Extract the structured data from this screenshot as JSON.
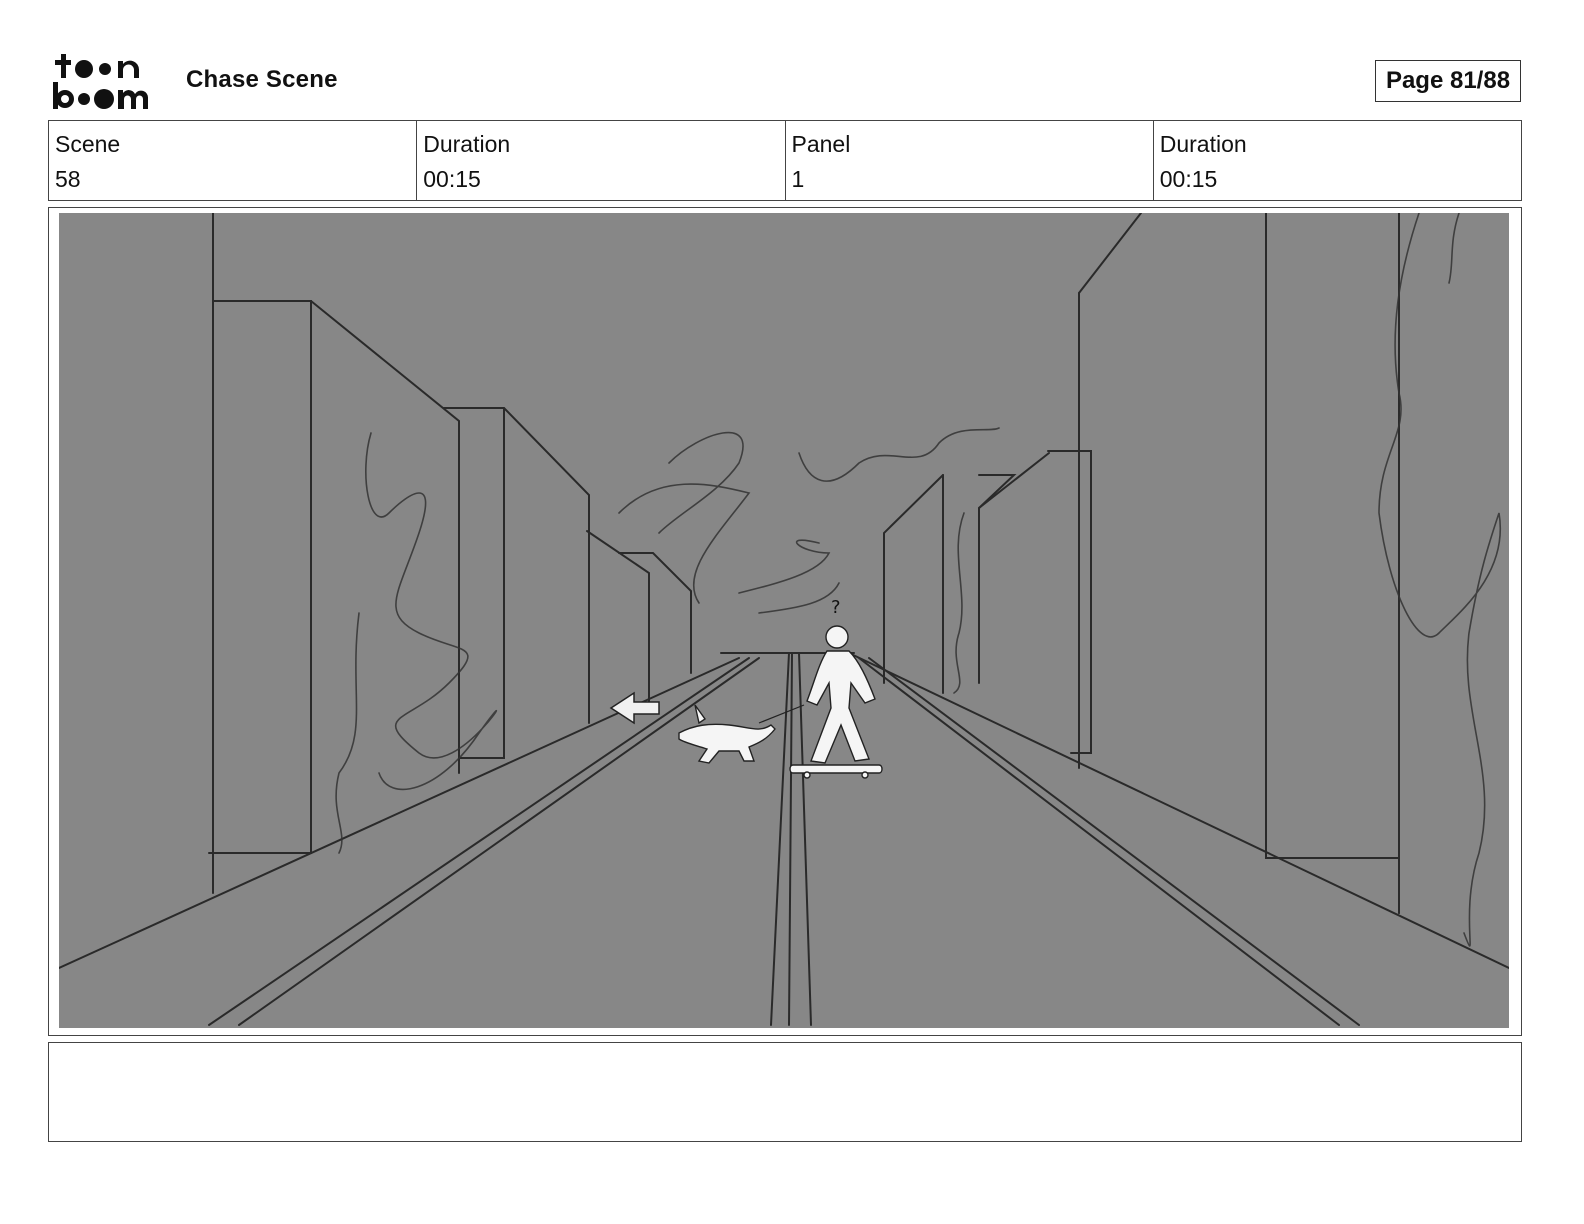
{
  "header": {
    "logo_text": "toonboom",
    "title": "Chase Scene",
    "page_label": "Page 81/88"
  },
  "info": [
    {
      "label": "Scene",
      "value": "58"
    },
    {
      "label": "Duration",
      "value": "00:15"
    },
    {
      "label": "Panel",
      "value": "1"
    },
    {
      "label": "Duration",
      "value": "00:15"
    }
  ],
  "panel": {
    "description": "",
    "sketch_question_mark": "?",
    "background_color": "#878787",
    "line_color": "#222222",
    "figure_color": "#f5f5f5"
  },
  "notes": {
    "text": ""
  }
}
